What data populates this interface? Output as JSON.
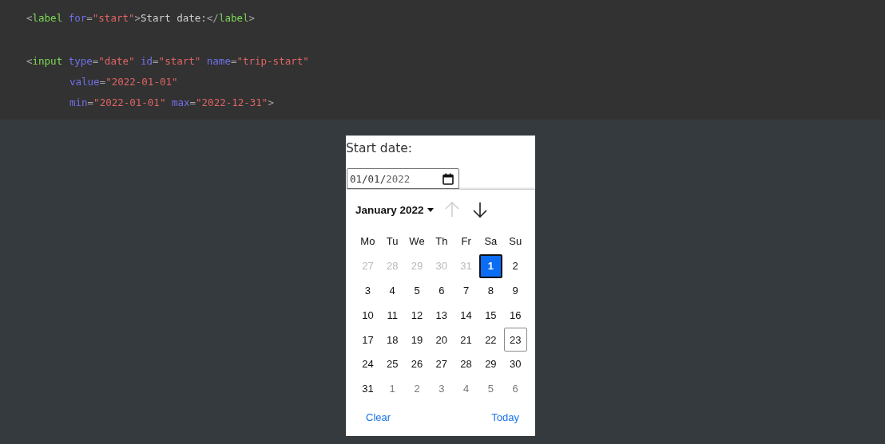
{
  "code": [
    {
      "indented": false,
      "spaced": false,
      "tokens": [
        {
          "kind": "punct",
          "text": "<"
        },
        {
          "kind": "tag",
          "text": "label"
        },
        {
          "kind": "attr",
          "text": " for"
        },
        {
          "kind": "punct",
          "text": "="
        },
        {
          "kind": "str",
          "text": "\"start\""
        },
        {
          "kind": "punct",
          "text": ">"
        },
        {
          "kind": "text",
          "text": "Start date:"
        },
        {
          "kind": "punct",
          "text": "</"
        },
        {
          "kind": "tag",
          "text": "label"
        },
        {
          "kind": "punct",
          "text": ">"
        }
      ]
    },
    {
      "indented": false,
      "spaced": true,
      "tokens": [
        {
          "kind": "punct",
          "text": "<"
        },
        {
          "kind": "tag",
          "text": "input"
        },
        {
          "kind": "attr",
          "text": " type"
        },
        {
          "kind": "punct",
          "text": "="
        },
        {
          "kind": "str",
          "text": "\"date\""
        },
        {
          "kind": "attr",
          "text": " id"
        },
        {
          "kind": "punct",
          "text": "="
        },
        {
          "kind": "str",
          "text": "\"start\""
        },
        {
          "kind": "attr",
          "text": " name"
        },
        {
          "kind": "punct",
          "text": "="
        },
        {
          "kind": "str",
          "text": "\"trip-start\""
        }
      ]
    },
    {
      "indented": true,
      "spaced": false,
      "tokens": [
        {
          "kind": "attr",
          "text": "value"
        },
        {
          "kind": "punct",
          "text": "="
        },
        {
          "kind": "str",
          "text": "\"2022-01-01\""
        }
      ]
    },
    {
      "indented": true,
      "spaced": false,
      "tokens": [
        {
          "kind": "attr",
          "text": "min"
        },
        {
          "kind": "punct",
          "text": "="
        },
        {
          "kind": "str",
          "text": "\"2022-01-01\""
        },
        {
          "kind": "attr",
          "text": " max"
        },
        {
          "kind": "punct",
          "text": "="
        },
        {
          "kind": "str",
          "text": "\"2022-12-31\""
        },
        {
          "kind": "punct",
          "text": ">"
        }
      ]
    }
  ],
  "label": "Start date:",
  "date_input": {
    "month_day": "01/01/",
    "year": "2022"
  },
  "picker": {
    "month_label": "January 2022",
    "weekdays": [
      "Mo",
      "Tu",
      "We",
      "Th",
      "Fr",
      "Sa",
      "Su"
    ],
    "days": [
      {
        "text": "27",
        "kind": "prev",
        "selected": false,
        "today": false
      },
      {
        "text": "28",
        "kind": "prev",
        "selected": false,
        "today": false
      },
      {
        "text": "29",
        "kind": "prev",
        "selected": false,
        "today": false
      },
      {
        "text": "30",
        "kind": "prev",
        "selected": false,
        "today": false
      },
      {
        "text": "31",
        "kind": "prev",
        "selected": false,
        "today": false
      },
      {
        "text": "1",
        "kind": "cur",
        "selected": true,
        "today": false
      },
      {
        "text": "2",
        "kind": "cur",
        "selected": false,
        "today": false
      },
      {
        "text": "3",
        "kind": "cur",
        "selected": false,
        "today": false
      },
      {
        "text": "4",
        "kind": "cur",
        "selected": false,
        "today": false
      },
      {
        "text": "5",
        "kind": "cur",
        "selected": false,
        "today": false
      },
      {
        "text": "6",
        "kind": "cur",
        "selected": false,
        "today": false
      },
      {
        "text": "7",
        "kind": "cur",
        "selected": false,
        "today": false
      },
      {
        "text": "8",
        "kind": "cur",
        "selected": false,
        "today": false
      },
      {
        "text": "9",
        "kind": "cur",
        "selected": false,
        "today": false
      },
      {
        "text": "10",
        "kind": "cur",
        "selected": false,
        "today": false
      },
      {
        "text": "11",
        "kind": "cur",
        "selected": false,
        "today": false
      },
      {
        "text": "12",
        "kind": "cur",
        "selected": false,
        "today": false
      },
      {
        "text": "13",
        "kind": "cur",
        "selected": false,
        "today": false
      },
      {
        "text": "14",
        "kind": "cur",
        "selected": false,
        "today": false
      },
      {
        "text": "15",
        "kind": "cur",
        "selected": false,
        "today": false
      },
      {
        "text": "16",
        "kind": "cur",
        "selected": false,
        "today": false
      },
      {
        "text": "17",
        "kind": "cur",
        "selected": false,
        "today": false
      },
      {
        "text": "18",
        "kind": "cur",
        "selected": false,
        "today": false
      },
      {
        "text": "19",
        "kind": "cur",
        "selected": false,
        "today": false
      },
      {
        "text": "20",
        "kind": "cur",
        "selected": false,
        "today": false
      },
      {
        "text": "21",
        "kind": "cur",
        "selected": false,
        "today": false
      },
      {
        "text": "22",
        "kind": "cur",
        "selected": false,
        "today": false
      },
      {
        "text": "23",
        "kind": "cur",
        "selected": false,
        "today": true
      },
      {
        "text": "24",
        "kind": "cur",
        "selected": false,
        "today": false
      },
      {
        "text": "25",
        "kind": "cur",
        "selected": false,
        "today": false
      },
      {
        "text": "26",
        "kind": "cur",
        "selected": false,
        "today": false
      },
      {
        "text": "27",
        "kind": "cur",
        "selected": false,
        "today": false
      },
      {
        "text": "28",
        "kind": "cur",
        "selected": false,
        "today": false
      },
      {
        "text": "29",
        "kind": "cur",
        "selected": false,
        "today": false
      },
      {
        "text": "30",
        "kind": "cur",
        "selected": false,
        "today": false
      },
      {
        "text": "31",
        "kind": "cur",
        "selected": false,
        "today": false
      },
      {
        "text": "1",
        "kind": "next",
        "selected": false,
        "today": false
      },
      {
        "text": "2",
        "kind": "next",
        "selected": false,
        "today": false
      },
      {
        "text": "3",
        "kind": "next",
        "selected": false,
        "today": false
      },
      {
        "text": "4",
        "kind": "next",
        "selected": false,
        "today": false
      },
      {
        "text": "5",
        "kind": "next",
        "selected": false,
        "today": false
      },
      {
        "text": "6",
        "kind": "next",
        "selected": false,
        "today": false
      }
    ],
    "prev_disabled": true,
    "next_disabled": false,
    "buttons": [
      "Clear",
      "Today"
    ]
  }
}
